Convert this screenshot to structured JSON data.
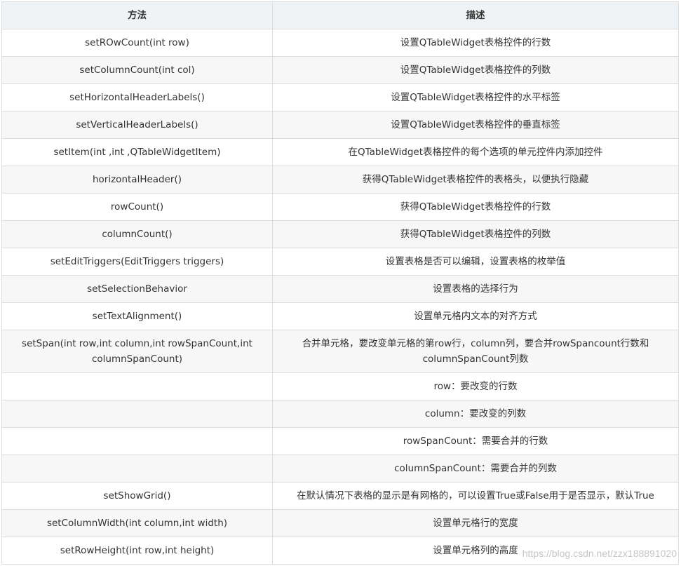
{
  "table": {
    "headers": [
      "方法",
      "描述"
    ],
    "rows": [
      {
        "method": "setROwCount(int row)",
        "desc": "设置QTableWidget表格控件的行数"
      },
      {
        "method": "setColumnCount(int col)",
        "desc": "设置QTableWidget表格控件的列数"
      },
      {
        "method": "setHorizontalHeaderLabels()",
        "desc": "设置QTableWidget表格控件的水平标签"
      },
      {
        "method": "setVerticalHeaderLabels()",
        "desc": "设置QTableWidget表格控件的垂直标签"
      },
      {
        "method": "setItem(int ,int ,QTableWidgetItem)",
        "desc": "在QTableWidget表格控件的每个选项的单元控件内添加控件"
      },
      {
        "method": "horizontalHeader()",
        "desc": "获得QTableWidget表格控件的表格头，以便执行隐藏"
      },
      {
        "method": "rowCount()",
        "desc": "获得QTableWidget表格控件的行数"
      },
      {
        "method": "columnCount()",
        "desc": "获得QTableWidget表格控件的列数"
      },
      {
        "method": "setEditTriggers(EditTriggers triggers)",
        "desc": "设置表格是否可以编辑，设置表格的枚举值"
      },
      {
        "method": "setSelectionBehavior",
        "desc": "设置表格的选择行为"
      },
      {
        "method": "setTextAlignment()",
        "desc": "设置单元格内文本的对齐方式"
      },
      {
        "method": "setSpan(int row,int column,int rowSpanCount,int columnSpanCount)",
        "desc": "合并单元格，要改变单元格的第row行，column列，要合并rowSpancount行数和columnSpanCount列数"
      },
      {
        "method": "",
        "desc": "row：要改变的行数"
      },
      {
        "method": "",
        "desc": "column：要改变的列数"
      },
      {
        "method": "",
        "desc": "rowSpanCount：需要合并的行数"
      },
      {
        "method": "",
        "desc": "columnSpanCount：需要合并的列数"
      },
      {
        "method": "setShowGrid()",
        "desc": "在默认情况下表格的显示是有网格的，可以设置True或False用于是否显示，默认True"
      },
      {
        "method": "setColumnWidth(int column,int width)",
        "desc": "设置单元格行的宽度"
      },
      {
        "method": "setRowHeight(int row,int height)",
        "desc": "设置单元格列的高度"
      }
    ]
  },
  "watermark": "https://blog.csdn.net/zzx188891020"
}
